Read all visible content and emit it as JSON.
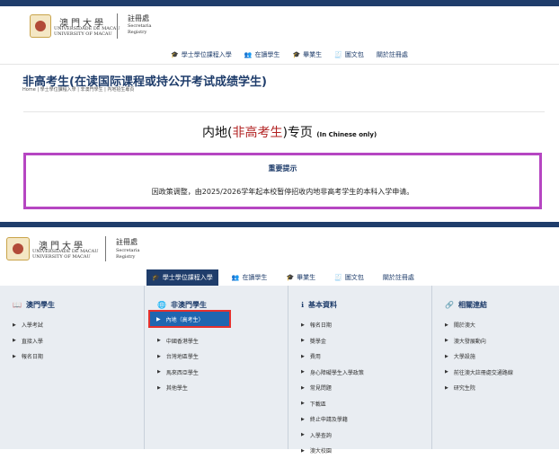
{
  "top": {
    "university_zh": "澳門大學",
    "university_en": "UNIVERSIDADE DE MACAU\nUNIVERSITY OF MACAU",
    "registry_zh": "註冊處",
    "registry_en": "Secretaria\nRegistry",
    "nav": [
      {
        "label": "學士學位課程入學",
        "icon": "graduation-icon"
      },
      {
        "label": "在讀學生",
        "icon": "people-icon"
      },
      {
        "label": "畢業生",
        "icon": "grad-cap-icon"
      },
      {
        "label": "圖文包",
        "icon": "bag-icon"
      },
      {
        "label": "關於註冊處",
        "icon": ""
      }
    ],
    "page_title": "非高考生(在读国际课程或持公开考试成绩学生)",
    "breadcrumb": "Home  |  學士學位課程入學  |  非澳門學生  |  內地招生專頁",
    "page_heading_prefix": "内地(",
    "page_heading_red": "非高考生",
    "page_heading_suffix": ")专页 ",
    "page_heading_note": "(In Chinese only)",
    "notice_title": "重要提示",
    "notice_body": "因政策调整，由2025/2026学年起本校暂停招收内地非高考学生的本科入学申请。"
  },
  "bottom": {
    "university_zh": "澳門大學",
    "university_en": "UNIVERSIDADE DE MACAU\nUNIVERSITY OF MACAU",
    "registry_zh": "註冊處",
    "registry_en": "Secretaria\nRegistry",
    "nav": [
      {
        "label": "學士學位課程入學",
        "icon": "graduation-icon",
        "active": true
      },
      {
        "label": "在讀學生",
        "icon": "people-icon"
      },
      {
        "label": "畢業生",
        "icon": "grad-cap-icon"
      },
      {
        "label": "圖文包",
        "icon": "bag-icon"
      },
      {
        "label": "關於註冊處",
        "icon": ""
      }
    ],
    "columns": [
      {
        "title": "澳門學生",
        "icon": "book-icon",
        "items": [
          "入學考試",
          "直接入學",
          "報名日期"
        ]
      },
      {
        "title": "非澳門學生",
        "icon": "globe-icon",
        "items": [
          "內地（高考生）",
          "中國香港學生",
          "台灣地區學生",
          "馬來西亞學生",
          "其他學生"
        ]
      },
      {
        "title": "基本資料",
        "icon": "info-icon",
        "items": [
          "報名日期",
          "獎學金",
          "費用",
          "身心障礙學生入學政策",
          "常見問題",
          "下載區",
          "終止申請及學籍",
          "入學查詢",
          "澳大校園"
        ]
      },
      {
        "title": "相關連結",
        "icon": "link-icon",
        "items": [
          "關於澳大",
          "澳大發展動向",
          "大學設施",
          "前往澳大註冊處交通路線",
          "研究生院"
        ]
      }
    ],
    "selected_item": "內地（高考生）"
  },
  "colors": {
    "brand_navy": "#1f3d6b",
    "notice_border": "#b646c2",
    "highlight_red": "#e5312e",
    "accent_red_text": "#b22222"
  }
}
